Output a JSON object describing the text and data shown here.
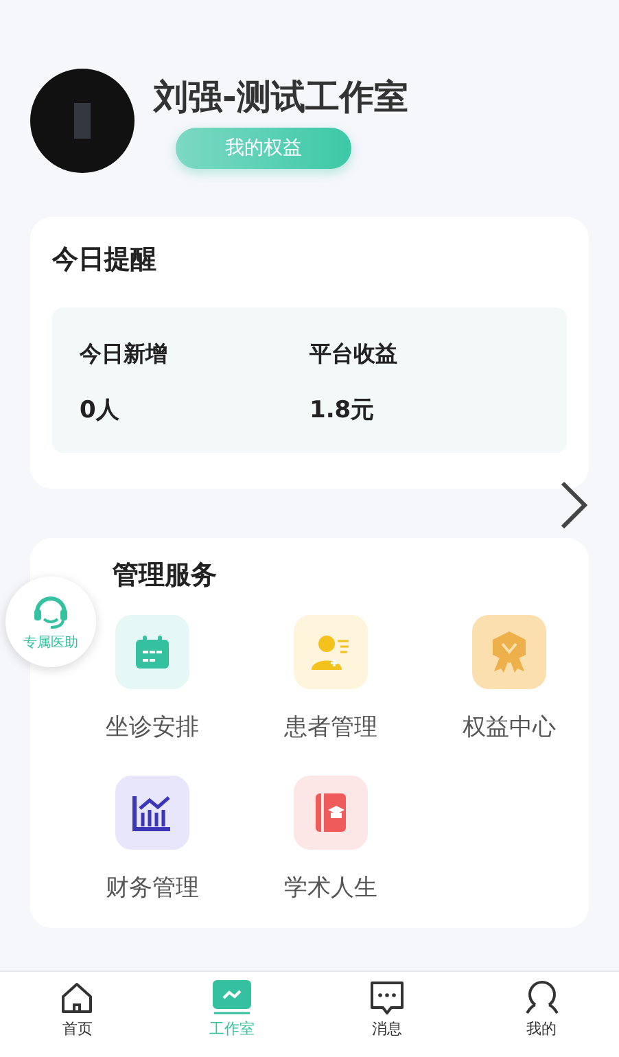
{
  "profile": {
    "name": "刘强-测试工作室",
    "benefits_button": "我的权益"
  },
  "reminder": {
    "title": "今日提醒",
    "stats": [
      {
        "label": "今日新增",
        "value": "0人"
      },
      {
        "label": "平台收益",
        "value": "1.8元"
      }
    ]
  },
  "services": {
    "title": "管理服务",
    "items": [
      {
        "kind": "calendar",
        "label": "坐诊安排"
      },
      {
        "kind": "patient",
        "label": "患者管理"
      },
      {
        "kind": "medal",
        "label": "权益中心"
      },
      {
        "kind": "finance",
        "label": "财务管理"
      },
      {
        "kind": "book",
        "label": "学术人生"
      }
    ]
  },
  "assistant": {
    "label": "专属医助"
  },
  "tabs": [
    {
      "kind": "home",
      "label": "首页",
      "selected": false
    },
    {
      "kind": "studio",
      "label": "工作室",
      "selected": true
    },
    {
      "kind": "message",
      "label": "消息",
      "selected": false
    },
    {
      "kind": "profile",
      "label": "我的",
      "selected": false
    }
  ]
}
